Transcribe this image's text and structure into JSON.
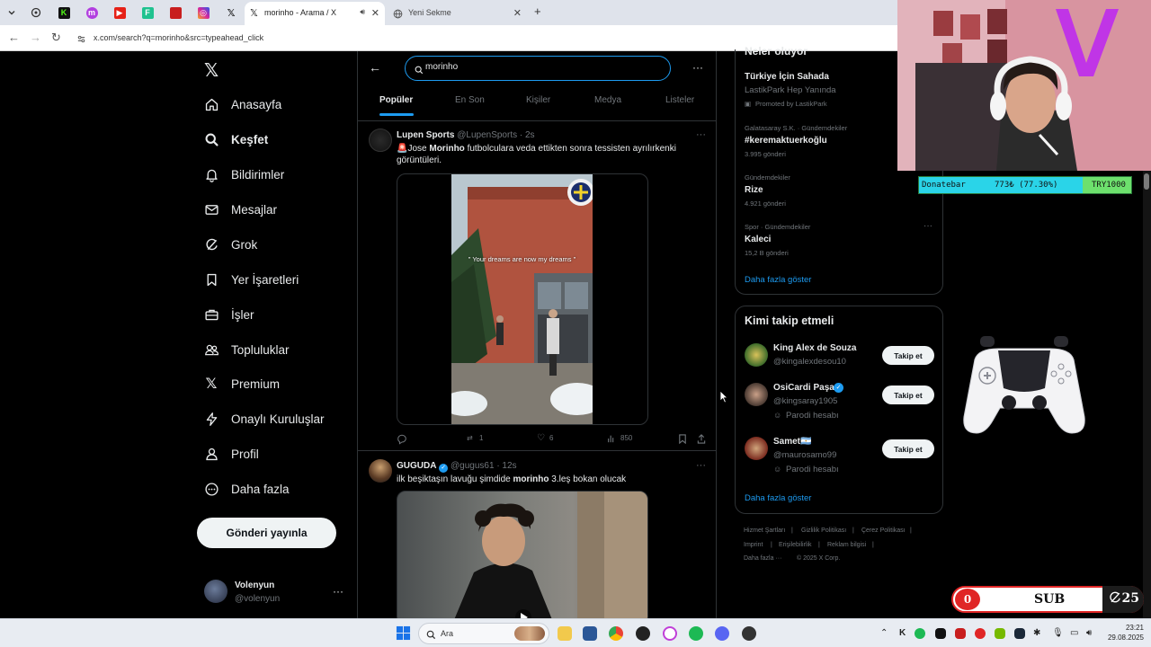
{
  "browser": {
    "active_tab": "morinho - Arama / X",
    "new_tab": "Yeni Sekme",
    "url": "x.com/search?q=morinho&src=typeahead_click"
  },
  "nav": {
    "items": [
      {
        "label": "Anasayfa",
        "icon": "home-icon"
      },
      {
        "label": "Keşfet",
        "icon": "search-icon"
      },
      {
        "label": "Bildirimler",
        "icon": "bell-icon"
      },
      {
        "label": "Mesajlar",
        "icon": "mail-icon"
      },
      {
        "label": "Grok",
        "icon": "grok-icon"
      },
      {
        "label": "Yer İşaretleri",
        "icon": "bookmark-icon"
      },
      {
        "label": "İşler",
        "icon": "briefcase-icon"
      },
      {
        "label": "Topluluklar",
        "icon": "people-icon"
      },
      {
        "label": "Premium",
        "icon": "x-premium-icon"
      },
      {
        "label": "Onaylı Kuruluşlar",
        "icon": "lightning-icon"
      },
      {
        "label": "Profil",
        "icon": "person-icon"
      },
      {
        "label": "Daha fazla",
        "icon": "more-circle-icon"
      }
    ],
    "post_button": "Gönderi yayınla",
    "account": {
      "name": "Volenyun",
      "handle": "@volenyun"
    }
  },
  "search": {
    "query": "morinho",
    "tabs": [
      "Popüler",
      "En Son",
      "Kişiler",
      "Medya",
      "Listeler"
    ]
  },
  "posts": [
    {
      "name": "Lupen Sports",
      "handle": "@LupenSports",
      "time": "· 2s",
      "text_pre": "🚨Jose ",
      "text_bold": "Morinho",
      "text_post": " futbolculara veda ettikten sonra tessisten ayrılırkenki görüntüleri.",
      "media_caption": "\" Your dreams are now my dreams \"",
      "replies": "",
      "reposts": "1",
      "likes": "6",
      "views": "850"
    },
    {
      "name": "GUGUDA",
      "handle": "@gugus61",
      "time": "· 12s",
      "text_pre": "ilk beşiktaşın lavuğu şimdide ",
      "text_bold": "morinho",
      "text_post": " 3.leş bokan olucak"
    }
  ],
  "trends": {
    "header": "Neler oluyor",
    "promoted": {
      "title": "Türkiye İçin Sahada",
      "subtitle": "LastikPark Hep Yanında",
      "note": "Promoted by LastikPark"
    },
    "items": [
      {
        "context": "Galatasaray S.K. · Gündemdekiler",
        "title": "#keremaktuerkoğlu",
        "count": "3.995 gönderi"
      },
      {
        "context": "Gündemdekiler",
        "title": "Rize",
        "count": "4.921 gönderi"
      },
      {
        "context": "Spor · Gündemdekiler",
        "title": "Kaleci",
        "count": "15,2 B gönderi"
      }
    ],
    "show_more": "Daha fazla göster"
  },
  "who_to_follow": {
    "title": "Kimi takip etmeli",
    "users": [
      {
        "name": "King Alex de Souza",
        "handle": "@kingalexdesou10",
        "note": "",
        "button": "Takip et"
      },
      {
        "name": "OsiCardi Paşa",
        "handle": "@kingsaray1905",
        "note": "Parodi hesabı",
        "button": "Takip et"
      },
      {
        "name": "Samet🇦🇷",
        "handle": "@maurosamo99",
        "note": "Parodi hesabı",
        "button": "Takip et"
      }
    ],
    "show_more": "Daha fazla göster"
  },
  "footer": {
    "links": [
      "Hizmet Şartları",
      "Gizlilik Politikası",
      "Çerez Politikası",
      "Imprint",
      "Erişilebilirlik",
      "Reklam bilgisi",
      "Daha fazla ···"
    ],
    "copyright": "© 2025 X Corp."
  },
  "overlay": {
    "donate_label": "Donatebar",
    "donate_amount": "773₺ (77.30%)",
    "donate_progress": 0.773,
    "donate_goal": "TRY1000",
    "sub_count": "0",
    "sub_label": "SUB",
    "sub_goal": "25"
  },
  "taskbar": {
    "search_label": "Ara",
    "time": "23:21",
    "date": "29.08.2025"
  },
  "colors": {
    "accent": "#1d9bf0",
    "background": "#000000",
    "text": "#e7e9ea",
    "muted": "#71767b"
  }
}
